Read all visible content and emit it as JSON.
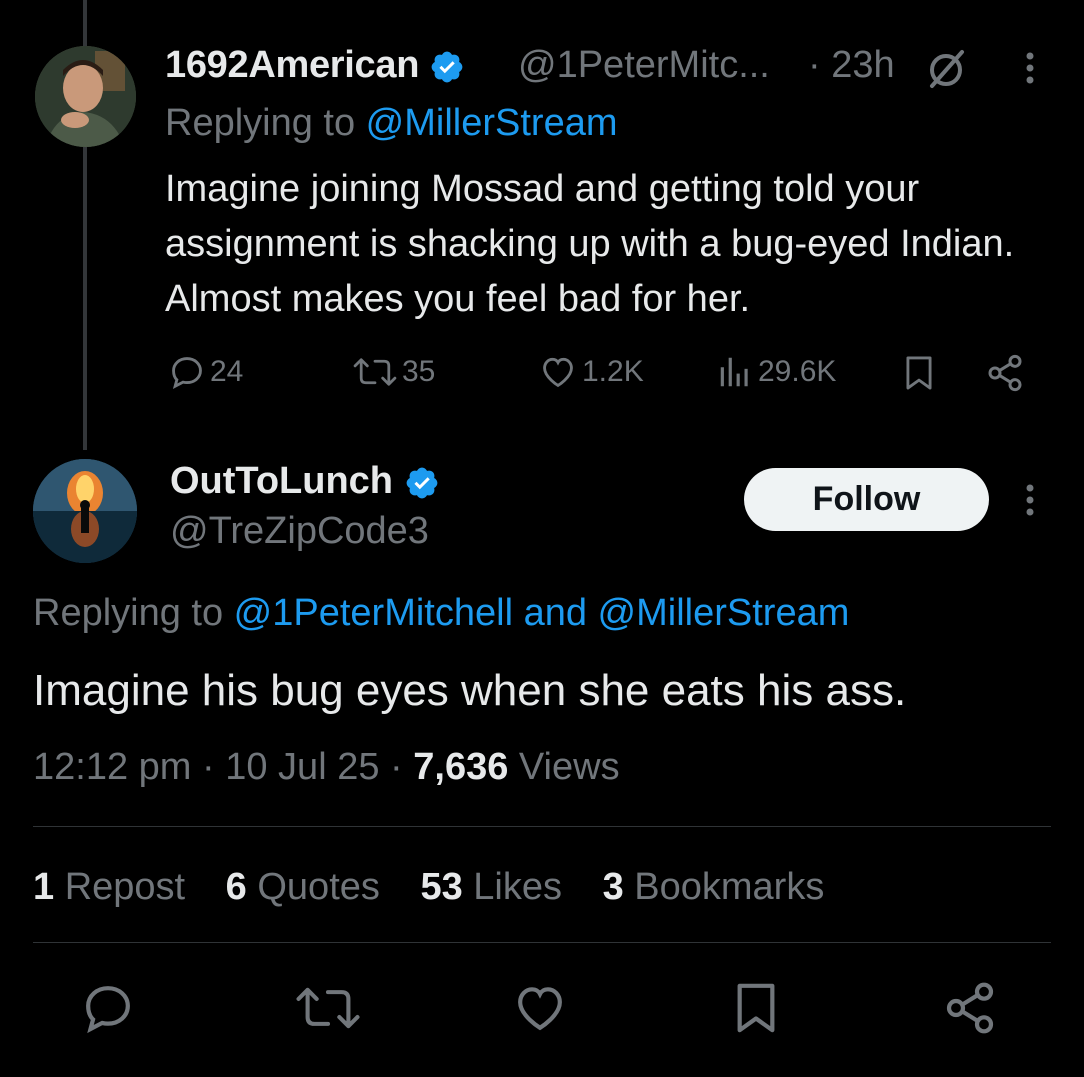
{
  "tweet1": {
    "display_name": "1692American",
    "handle": "@1PeterMitc...",
    "time": "· 23h",
    "replying_prefix": "Replying to ",
    "replying_to": "@MillerStream",
    "text": "Imagine joining Mossad and getting told your assignment is shacking up with a bug-eyed Indian. Almost makes you feel bad for her.",
    "replies": "24",
    "reposts": "35",
    "likes": "1.2K",
    "views": "29.6K"
  },
  "tweet2": {
    "display_name": "OutToLunch",
    "handle": "@TreZipCode3",
    "follow_label": "Follow",
    "replying_prefix": "Replying to ",
    "replying_to_1": "@1PeterMitchell",
    "replying_and": " and ",
    "replying_to_2": "@MillerStream",
    "text": "Imagine his bug eyes when she eats his ass.",
    "time": "12:12 pm",
    "sep1": " · ",
    "date": "10 Jul 25",
    "sep2": " · ",
    "views_count": "7,636",
    "views_label": " Views",
    "stats": {
      "reposts_count": "1",
      "reposts_label": " Repost",
      "quotes_count": "6",
      "quotes_label": " Quotes",
      "likes_count": "53",
      "likes_label": " Likes",
      "bookmarks_count": "3",
      "bookmarks_label": " Bookmarks"
    }
  },
  "colors": {
    "background": "#000000",
    "text": "#e7e9ea",
    "muted": "#71767b",
    "link": "#1d9bf0",
    "verified": "#1d9bf0",
    "divider": "#2f3336"
  },
  "icons": [
    "verified-badge-icon",
    "grok-icon",
    "more-icon",
    "reply-icon",
    "repost-icon",
    "like-icon",
    "views-icon",
    "bookmark-icon",
    "share-icon"
  ]
}
